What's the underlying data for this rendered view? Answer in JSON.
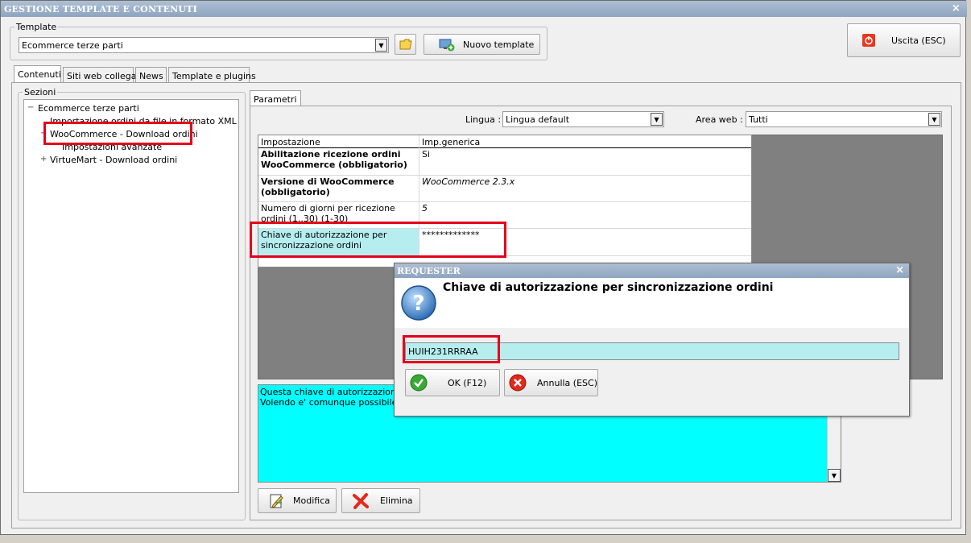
{
  "window": {
    "title": "GESTIONE TEMPLATE E CONTENUTI",
    "close_glyph": "×"
  },
  "template_group": {
    "label": "Template",
    "selected": "Ecommerce terze parti",
    "new_button": "Nuovo template"
  },
  "exit_button": "Uscita (ESC)",
  "main_tabs": [
    "Contenuti",
    "Siti web collegati",
    "News",
    "Template e plugins"
  ],
  "sections": {
    "label": "Sezioni",
    "tree": [
      {
        "label": "Ecommerce terze parti",
        "expander": "−"
      },
      {
        "label": "Importazione ordini da file in formato XML",
        "expander": ""
      },
      {
        "label": "WooCommerce - Download ordini",
        "expander": "−"
      },
      {
        "label": "Impostazioni avanzate",
        "expander": ""
      },
      {
        "label": "VirtueMart - Download ordini",
        "expander": "+"
      }
    ]
  },
  "params": {
    "tab": "Parametri",
    "lingua_label": "Lingua :",
    "lingua_value": "Lingua default",
    "area_label": "Area web :",
    "area_value": "Tutti",
    "headers": [
      "Impostazione",
      "Imp.generica"
    ],
    "rows": [
      {
        "name": "Abilitazione ricezione ordini WooCommerce (obbligatorio)",
        "value": "Si"
      },
      {
        "name": "Versione di WooCommerce (obbligatorio)",
        "value": "WooCommerce 2.3.x"
      },
      {
        "name": "Numero di giorni per ricezione ordini (1..30) (1-30)",
        "value": "5"
      },
      {
        "name": "Chiave di autorizzazione per sincronizzazione ordini",
        "value": "*************"
      }
    ],
    "description_line1": "Questa chiave di autorizzazione vie",
    "description_line2": "Volendo e' comunque possibile mod",
    "modify_button": "Modifica",
    "delete_button": "Elimina"
  },
  "dialog": {
    "title": "REQUESTER",
    "close_glyph": "×",
    "question": "Chiave di autorizzazione per sincronizzazione ordini",
    "input_value": "HUIH231RRRAA",
    "ok_button": "OK (F12)",
    "cancel_button": "Annulla (ESC)"
  },
  "colors": {
    "highlight": "#e3001b",
    "cyan_field": "#00ffff",
    "selected_row": "#b6eef0",
    "grid_empty": "#808080"
  }
}
